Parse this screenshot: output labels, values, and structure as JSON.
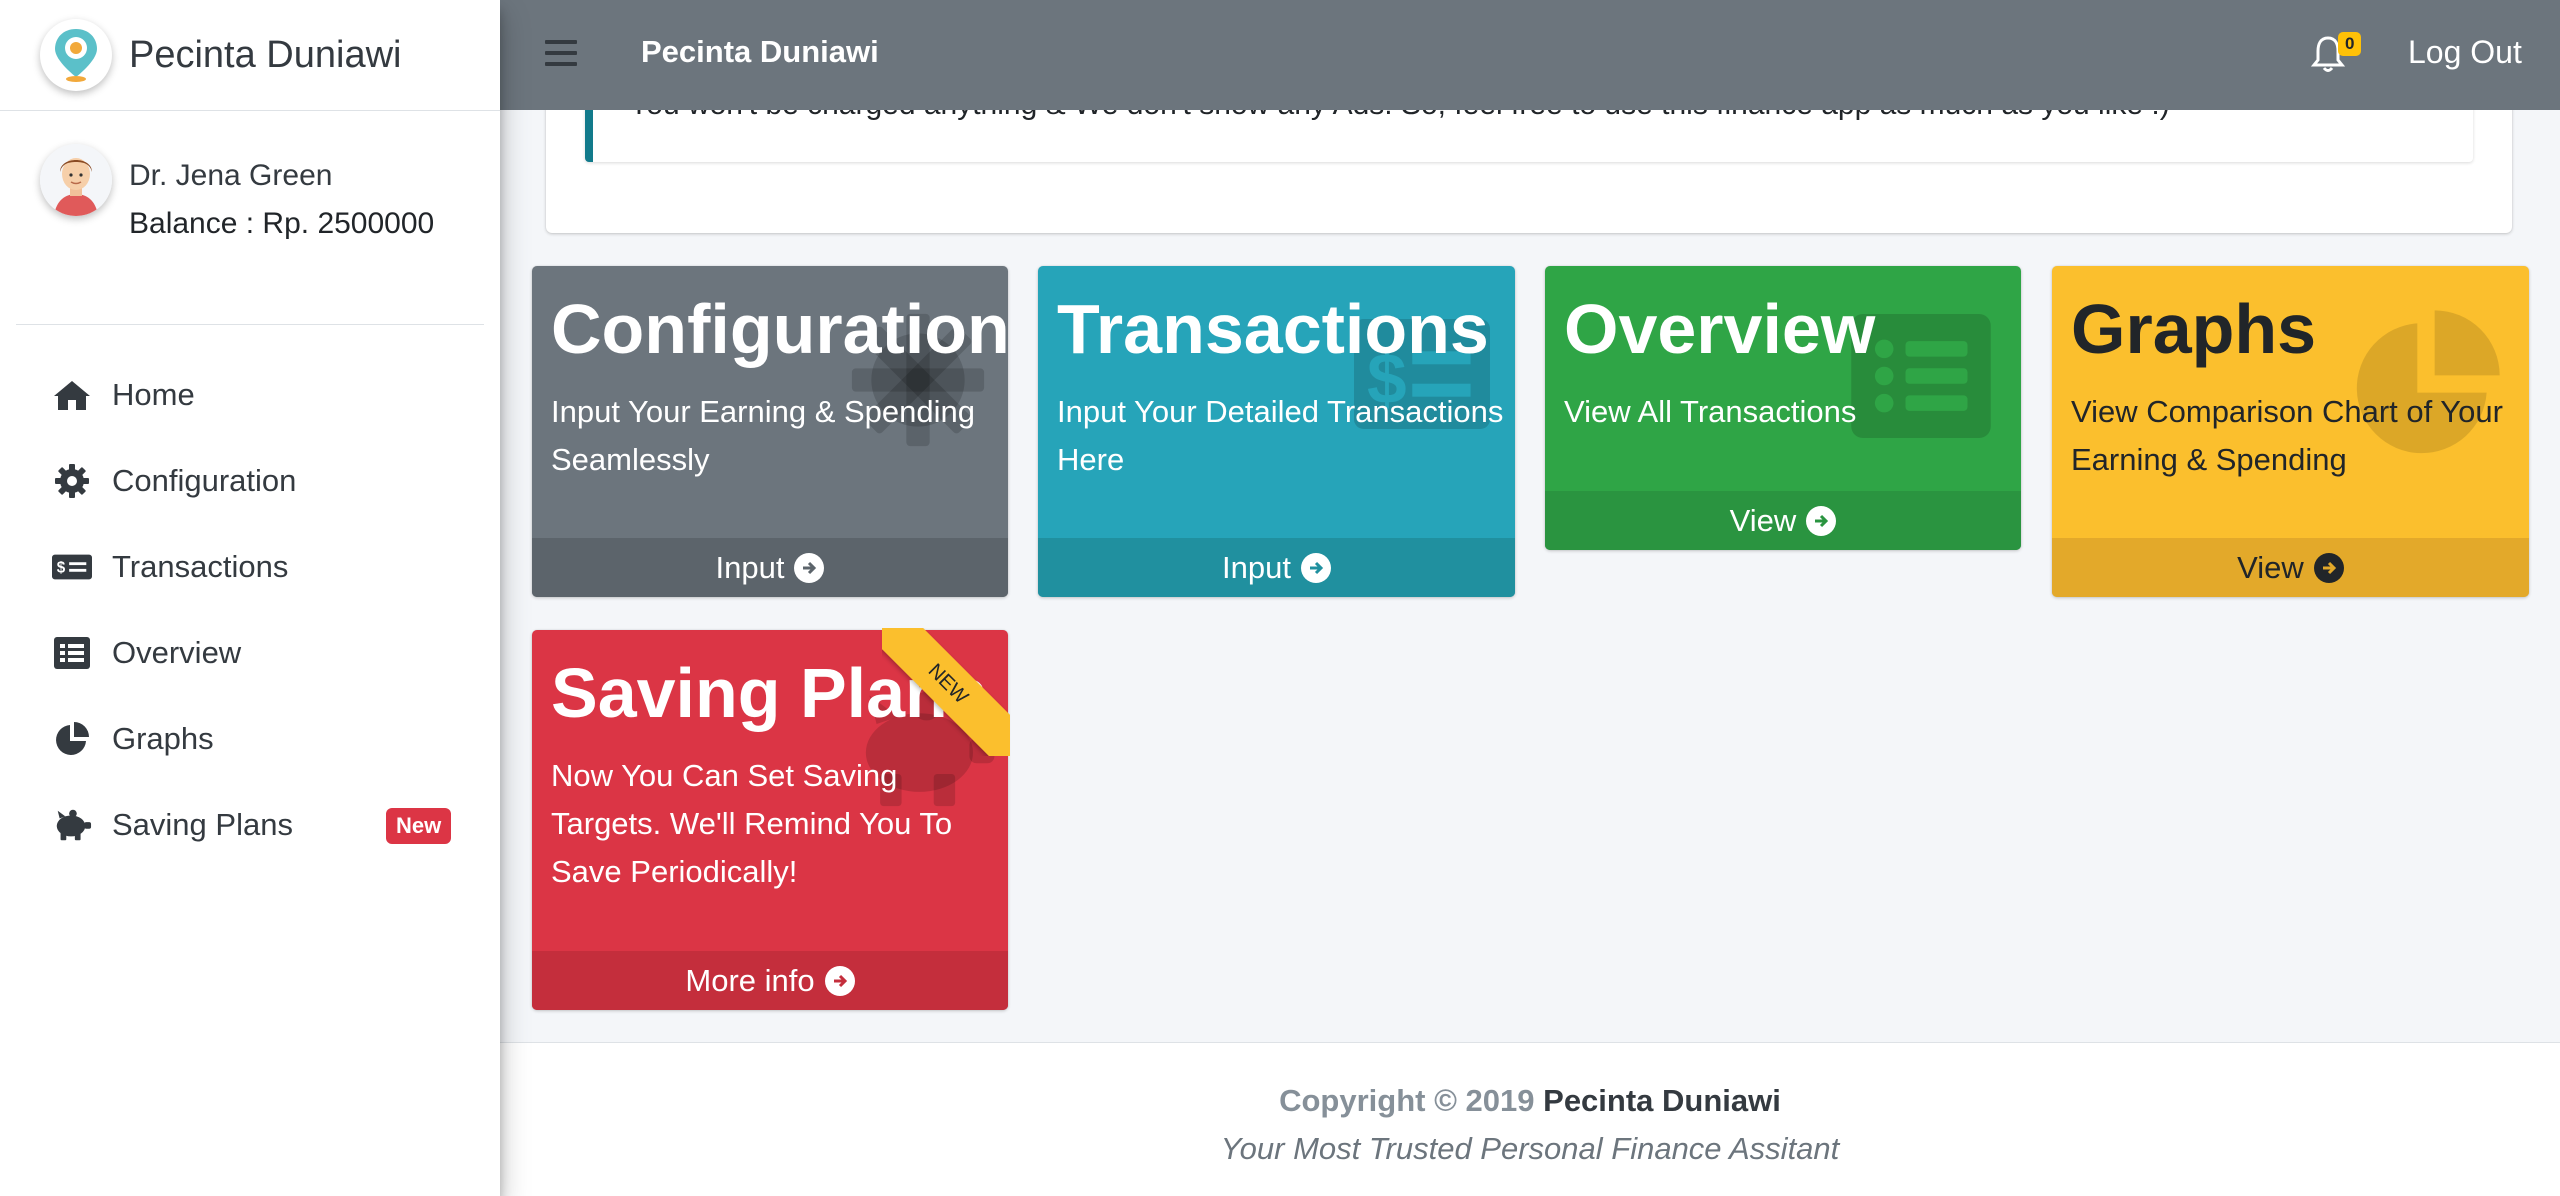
{
  "brand": {
    "name": "Pecinta Duniawi",
    "logo_icon": "location-pin-logo-icon"
  },
  "user": {
    "name": "Dr. Jena Green",
    "balance": "Balance : Rp. 2500000",
    "avatar_icon": "user-avatar-icon"
  },
  "sidebar": {
    "items": [
      {
        "label": "Home",
        "icon": "home-icon"
      },
      {
        "label": "Configuration",
        "icon": "gear-icon"
      },
      {
        "label": "Transactions",
        "icon": "money-check-icon"
      },
      {
        "label": "Overview",
        "icon": "list-icon"
      },
      {
        "label": "Graphs",
        "icon": "pie-chart-icon"
      },
      {
        "label": "Saving Plans",
        "icon": "piggy-bank-icon",
        "badge": "New"
      }
    ]
  },
  "navbar": {
    "title": "Pecinta Duniawi",
    "notification_count": "0",
    "logout_label": "Log Out"
  },
  "info": {
    "text": "You won't be charged anything & We don't show any Ads. So, feel free to use this finance app as much as you like :)"
  },
  "cards": [
    {
      "title": "Configuration",
      "description": "Input Your Earning & Spending Seamlessly",
      "footer": "Input",
      "color": "#6c757d",
      "icon": "gear-icon"
    },
    {
      "title": "Transactions",
      "description": "Input Your Detailed Transactions Here",
      "footer": "Input",
      "color": "#26a4b9",
      "icon": "money-check-icon"
    },
    {
      "title": "Overview",
      "description": "View All Transactions",
      "footer": "View",
      "color": "#2fa546",
      "icon": "list-icon"
    },
    {
      "title": "Graphs",
      "description": "View Comparison Chart of Your Earning & Spending",
      "footer": "View",
      "color": "#fbbf2d",
      "icon": "pie-chart-icon"
    },
    {
      "title": "Saving Plans",
      "description": "Now You Can Set Saving Targets. We'll Remind You To Save Periodically!",
      "footer": "More info",
      "color": "#db3545",
      "icon": "piggy-bank-icon",
      "ribbon": "NEW"
    }
  ],
  "footer": {
    "copyright": "Copyright © 2019",
    "brand": "Pecinta Duniawi",
    "tagline": "Your Most Trusted Personal Finance Assitant"
  }
}
